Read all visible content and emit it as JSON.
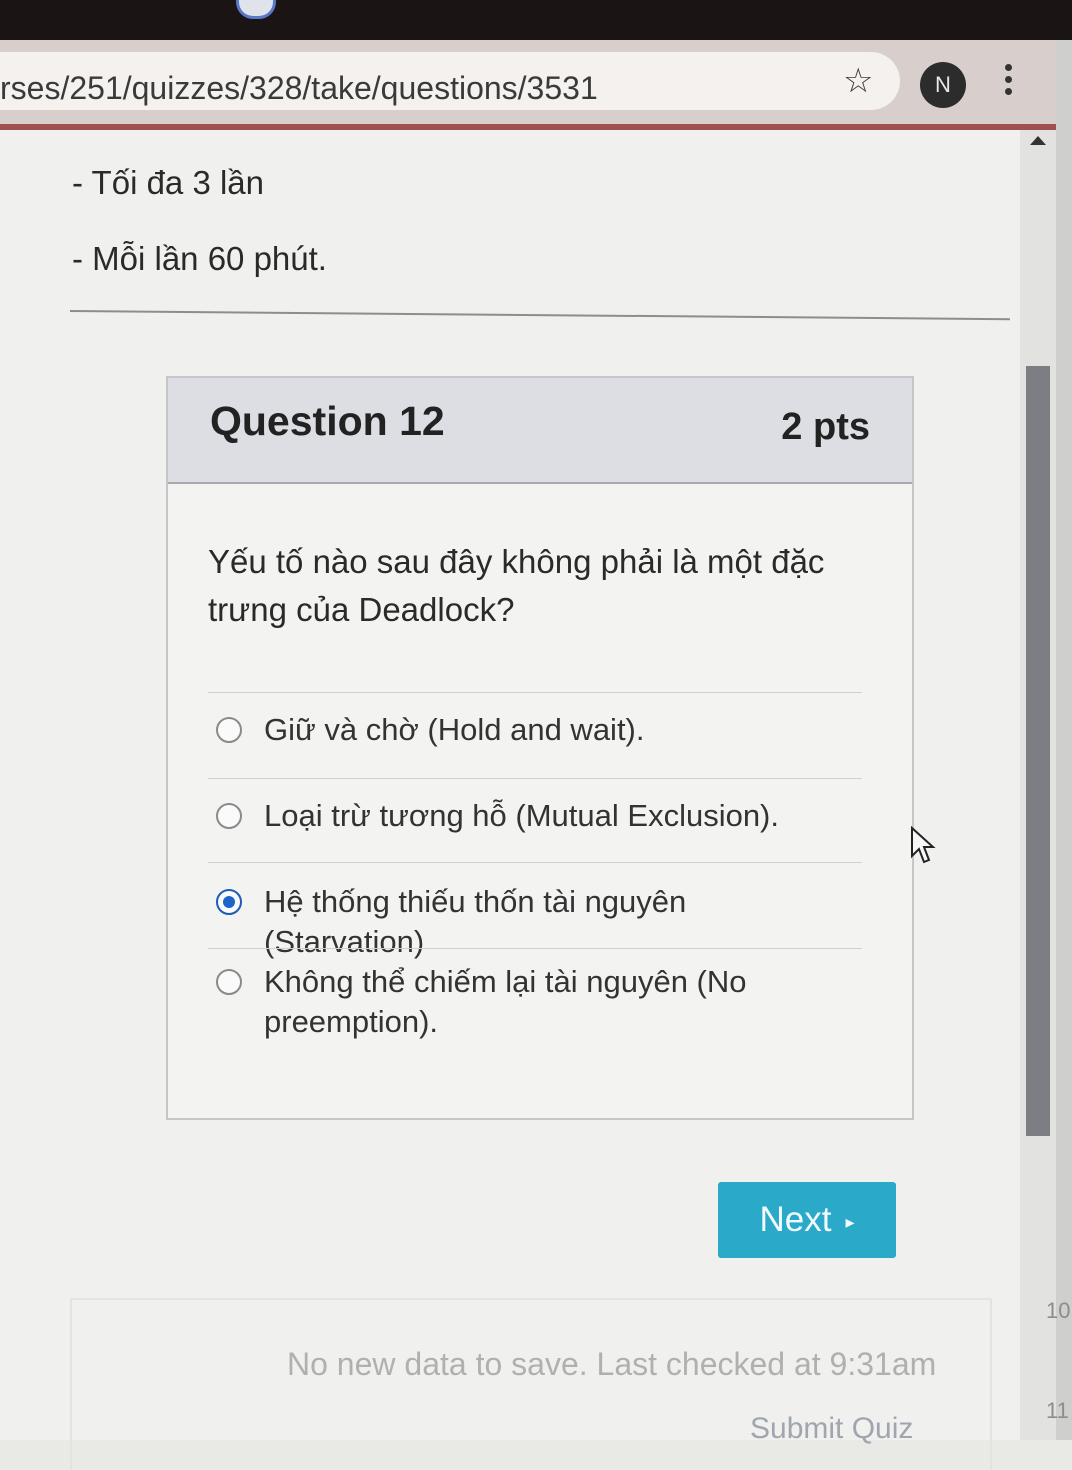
{
  "browser": {
    "url": "rses/251/quizzes/328/take/questions/3531",
    "profile_initial": "N"
  },
  "quiz_info": {
    "attempts_line": "- Tối đa 3 lần",
    "time_line": "- Mỗi lần 60 phút."
  },
  "question": {
    "title": "Question 12",
    "points": "2 pts",
    "text": "Yếu tố nào sau đây không phải là một đặc trưng của Deadlock?",
    "answers": [
      {
        "label": "Giữ và chờ (Hold and wait).",
        "selected": false
      },
      {
        "label": "Loại trừ tương hỗ (Mutual Exclusion).",
        "selected": false
      },
      {
        "label": "Hệ thống thiếu thốn tài nguyên (Starvation)",
        "selected": true
      },
      {
        "label": "Không thể chiếm lại tài nguyên (No preemption).",
        "selected": false
      }
    ]
  },
  "navigation": {
    "next_label": "Next",
    "next_arrow": "▸"
  },
  "footer": {
    "status": "No new data to save. Last checked at 9:31am",
    "submit_label": "Submit Quiz"
  },
  "sidebar_numbers": [
    "10",
    "11"
  ],
  "colors": {
    "accent": "#2ba9c9",
    "selected_radio": "#1e64c8"
  }
}
